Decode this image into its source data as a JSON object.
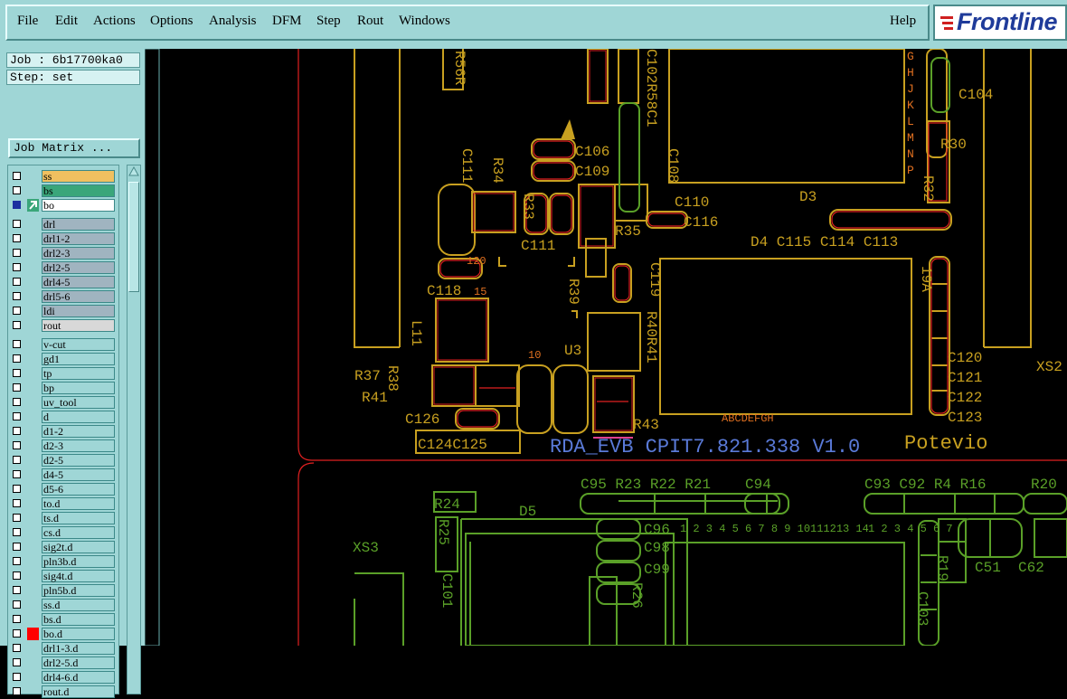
{
  "menu": {
    "items": [
      "File",
      "Edit",
      "Actions",
      "Options",
      "Analysis",
      "DFM",
      "Step",
      "Rout",
      "Windows"
    ],
    "help": "Help"
  },
  "logo": {
    "text": "Frontline"
  },
  "job": {
    "label": "Job : 6b17700ka0",
    "step": "Step: set"
  },
  "job_matrix": "Job Matrix ...",
  "layers": [
    {
      "name": "ss",
      "color": "#f0c060",
      "box": "empty",
      "flag": ""
    },
    {
      "name": "bs",
      "color": "#3aa67a",
      "box": "empty",
      "flag": ""
    },
    {
      "name": "bo",
      "color": "#ffffff",
      "box": "filled",
      "flag": "arrow"
    },
    {
      "name": "drl",
      "color": "#a0b4c0",
      "box": "empty",
      "flag": ""
    },
    {
      "name": "drl1-2",
      "color": "#a0b4c0",
      "box": "empty",
      "flag": ""
    },
    {
      "name": "drl2-3",
      "color": "#a0b4c0",
      "box": "empty",
      "flag": ""
    },
    {
      "name": "drl2-5",
      "color": "#a0b4c0",
      "box": "empty",
      "flag": ""
    },
    {
      "name": "drl4-5",
      "color": "#a0b4c0",
      "box": "empty",
      "flag": ""
    },
    {
      "name": "drl5-6",
      "color": "#a0b4c0",
      "box": "empty",
      "flag": ""
    },
    {
      "name": "ldi",
      "color": "#a0b4c0",
      "box": "empty",
      "flag": ""
    },
    {
      "name": "rout",
      "color": "#d8d8d8",
      "box": "empty",
      "flag": ""
    },
    {
      "name": "v-cut",
      "color": "#9fd6d6",
      "box": "empty",
      "flag": ""
    },
    {
      "name": "gd1",
      "color": "#9fd6d6",
      "box": "empty",
      "flag": ""
    },
    {
      "name": "tp",
      "color": "#9fd6d6",
      "box": "empty",
      "flag": ""
    },
    {
      "name": "bp",
      "color": "#9fd6d6",
      "box": "empty",
      "flag": ""
    },
    {
      "name": "uv_tool",
      "color": "#9fd6d6",
      "box": "empty",
      "flag": ""
    },
    {
      "name": "d",
      "color": "#9fd6d6",
      "box": "empty",
      "flag": ""
    },
    {
      "name": "d1-2",
      "color": "#9fd6d6",
      "box": "empty",
      "flag": ""
    },
    {
      "name": "d2-3",
      "color": "#9fd6d6",
      "box": "empty",
      "flag": ""
    },
    {
      "name": "d2-5",
      "color": "#9fd6d6",
      "box": "empty",
      "flag": ""
    },
    {
      "name": "d4-5",
      "color": "#9fd6d6",
      "box": "empty",
      "flag": ""
    },
    {
      "name": "d5-6",
      "color": "#9fd6d6",
      "box": "empty",
      "flag": ""
    },
    {
      "name": "to.d",
      "color": "#9fd6d6",
      "box": "empty",
      "flag": ""
    },
    {
      "name": "ts.d",
      "color": "#9fd6d6",
      "box": "empty",
      "flag": ""
    },
    {
      "name": "cs.d",
      "color": "#9fd6d6",
      "box": "empty",
      "flag": ""
    },
    {
      "name": "sig2t.d",
      "color": "#9fd6d6",
      "box": "empty",
      "flag": ""
    },
    {
      "name": "pln3b.d",
      "color": "#9fd6d6",
      "box": "empty",
      "flag": ""
    },
    {
      "name": "sig4t.d",
      "color": "#9fd6d6",
      "box": "empty",
      "flag": ""
    },
    {
      "name": "pln5b.d",
      "color": "#9fd6d6",
      "box": "empty",
      "flag": ""
    },
    {
      "name": "ss.d",
      "color": "#9fd6d6",
      "box": "empty",
      "flag": ""
    },
    {
      "name": "bs.d",
      "color": "#9fd6d6",
      "box": "empty",
      "flag": ""
    },
    {
      "name": "bo.d",
      "color": "#9fd6d6",
      "box": "empty",
      "flag": "red"
    },
    {
      "name": "drl1-3.d",
      "color": "#9fd6d6",
      "box": "empty",
      "flag": ""
    },
    {
      "name": "drl2-5.d",
      "color": "#9fd6d6",
      "box": "empty",
      "flag": ""
    },
    {
      "name": "drl4-6.d",
      "color": "#9fd6d6",
      "box": "empty",
      "flag": ""
    },
    {
      "name": "rout.d",
      "color": "#9fd6d6",
      "box": "empty",
      "flag": ""
    }
  ],
  "canvas": {
    "colors": {
      "yellow": "#c8a020",
      "red": "#e02020",
      "green": "#5aa028",
      "blue": "#5a7ad8",
      "orange": "#e07020"
    },
    "texts": {
      "board_label": "RDA_EVB CPIT7.821.338 V1.0",
      "board_label2": "Poteviо",
      "labels_yellow": [
        "C106",
        "C109",
        "C110",
        "C116",
        "C111",
        "C118",
        "R35",
        "R33",
        "D3",
        "C115",
        "C114",
        "C113",
        "D4",
        "R30",
        "C104",
        "R39",
        "U3",
        "R37",
        "R38",
        "R41",
        "C126",
        "C124C125",
        "C120",
        "C121",
        "C122",
        "C123",
        "XS2",
        "R43",
        "C108",
        "C102R58C1"
      ],
      "labels_green": [
        "R24",
        "D5",
        "C95",
        "R23",
        "R22",
        "R21",
        "C94",
        "C93",
        "C92",
        "R4",
        "R16",
        "R20",
        "XS3",
        "C98",
        "C99",
        "C97",
        "C101",
        "C51",
        "C62",
        "R19",
        "R25"
      ]
    }
  }
}
